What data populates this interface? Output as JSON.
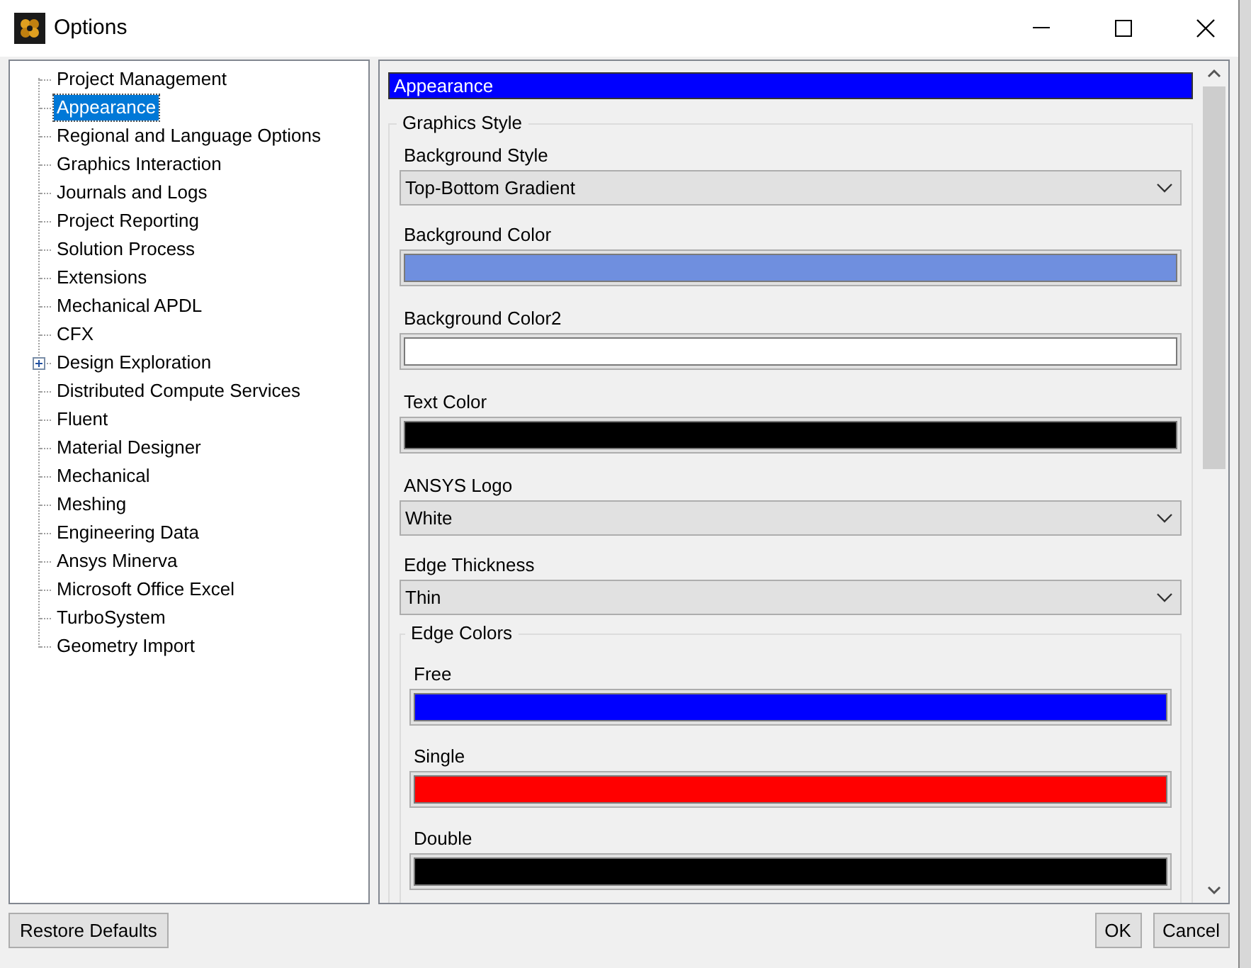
{
  "window": {
    "title": "Options"
  },
  "tree": [
    {
      "label": "Project Management",
      "kind": "leaf",
      "selected": false
    },
    {
      "label": "Appearance",
      "kind": "leaf",
      "selected": true
    },
    {
      "label": "Regional and Language Options",
      "kind": "leaf",
      "selected": false
    },
    {
      "label": "Graphics Interaction",
      "kind": "leaf",
      "selected": false
    },
    {
      "label": "Journals and Logs",
      "kind": "leaf",
      "selected": false
    },
    {
      "label": "Project Reporting",
      "kind": "leaf",
      "selected": false
    },
    {
      "label": "Solution Process",
      "kind": "leaf",
      "selected": false
    },
    {
      "label": "Extensions",
      "kind": "leaf",
      "selected": false
    },
    {
      "label": "Mechanical APDL",
      "kind": "leaf",
      "selected": false
    },
    {
      "label": "CFX",
      "kind": "leaf",
      "selected": false
    },
    {
      "label": "Design Exploration",
      "kind": "collapsed",
      "selected": false
    },
    {
      "label": "Distributed Compute Services",
      "kind": "leaf",
      "selected": false
    },
    {
      "label": "Fluent",
      "kind": "leaf",
      "selected": false
    },
    {
      "label": "Material Designer",
      "kind": "leaf",
      "selected": false
    },
    {
      "label": "Mechanical",
      "kind": "leaf",
      "selected": false
    },
    {
      "label": "Meshing",
      "kind": "leaf",
      "selected": false
    },
    {
      "label": "Engineering Data",
      "kind": "leaf",
      "selected": false
    },
    {
      "label": "Ansys Minerva",
      "kind": "leaf",
      "selected": false
    },
    {
      "label": "Microsoft Office Excel",
      "kind": "leaf",
      "selected": false
    },
    {
      "label": "TurboSystem",
      "kind": "leaf",
      "selected": false
    },
    {
      "label": "Geometry Import",
      "kind": "leaf",
      "selected": false
    }
  ],
  "page": {
    "heading": "Appearance",
    "group": {
      "title": "Graphics Style",
      "fields": [
        {
          "label": "Background Style",
          "kind": "dropdown",
          "value": "Top-Bottom Gradient"
        },
        {
          "label": "Background Color",
          "kind": "color",
          "color": "#6f8fdf"
        },
        {
          "label": "Background Color2",
          "kind": "color",
          "color": "#ffffff"
        },
        {
          "label": "Text Color",
          "kind": "color",
          "color": "#000000"
        },
        {
          "label": "ANSYS Logo",
          "kind": "dropdown",
          "value": "White"
        },
        {
          "label": "Edge Thickness",
          "kind": "dropdown",
          "value": "Thin"
        }
      ],
      "subgroup": {
        "title": "Edge Colors",
        "fields": [
          {
            "label": "Free",
            "kind": "color",
            "color": "#0000ff"
          },
          {
            "label": "Single",
            "kind": "color",
            "color": "#ff0000"
          },
          {
            "label": "Double",
            "kind": "color",
            "color": "#000000"
          }
        ]
      }
    }
  },
  "buttons": {
    "restore": "Restore Defaults",
    "ok": "OK",
    "cancel": "Cancel"
  }
}
